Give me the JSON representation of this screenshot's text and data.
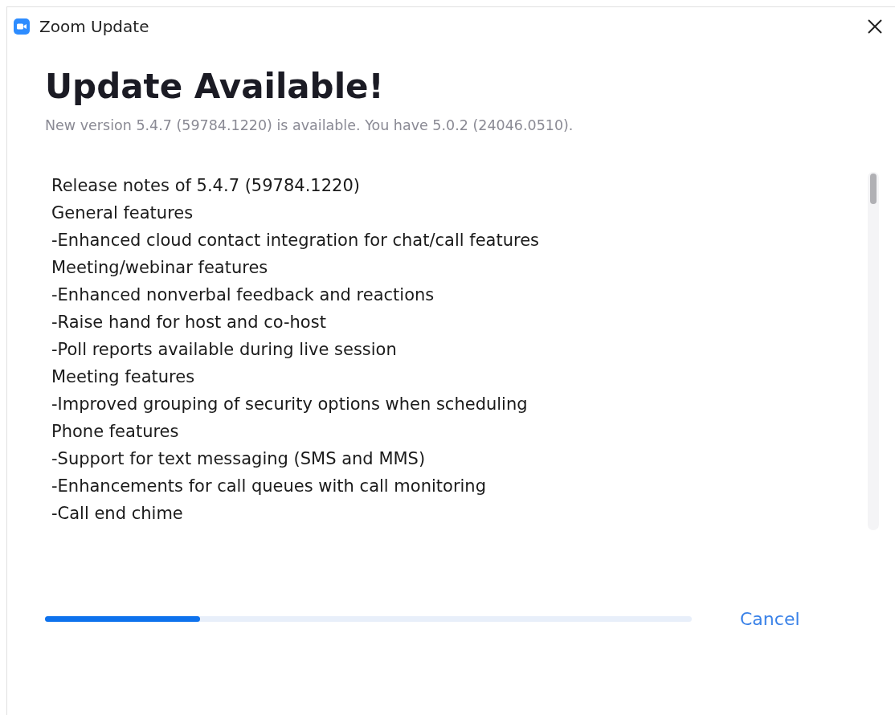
{
  "window": {
    "title": "Zoom Update"
  },
  "heading": "Update Available!",
  "subtitle": "New version 5.4.7 (59784.1220) is available. You have 5.0.2 (24046.0510).",
  "release_notes": [
    "Release notes of 5.4.7 (59784.1220)",
    "General features",
    "-Enhanced cloud contact integration for chat/call features",
    "Meeting/webinar features",
    "-Enhanced nonverbal feedback and reactions",
    "-Raise hand for host and co-host",
    "-Poll reports available during live session",
    "Meeting features",
    "-Improved grouping of security options when scheduling",
    "Phone features",
    "-Support for text messaging (SMS and MMS)",
    "-Enhancements for call queues with call monitoring",
    "-Call end chime"
  ],
  "progress": {
    "level": 0.24
  },
  "cancel_button": "Cancel"
}
